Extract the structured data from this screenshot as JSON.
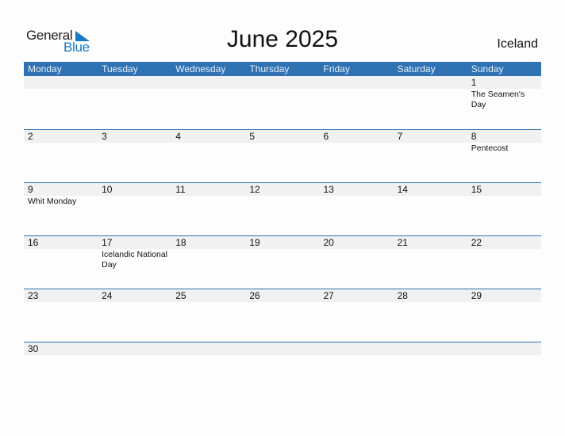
{
  "logo": {
    "line1": "General",
    "line2": "Blue"
  },
  "title": "June 2025",
  "country": "Iceland",
  "colors": {
    "accent": "#2e72b3",
    "strip": "#f1f1f1",
    "logo_blue": "#1a7bc4"
  },
  "weekdays": [
    "Monday",
    "Tuesday",
    "Wednesday",
    "Thursday",
    "Friday",
    "Saturday",
    "Sunday"
  ],
  "weeks": [
    {
      "days": [
        {
          "num": "",
          "event": ""
        },
        {
          "num": "",
          "event": ""
        },
        {
          "num": "",
          "event": ""
        },
        {
          "num": "",
          "event": ""
        },
        {
          "num": "",
          "event": ""
        },
        {
          "num": "",
          "event": ""
        },
        {
          "num": "1",
          "event": "The Seamen's Day"
        }
      ]
    },
    {
      "days": [
        {
          "num": "2",
          "event": ""
        },
        {
          "num": "3",
          "event": ""
        },
        {
          "num": "4",
          "event": ""
        },
        {
          "num": "5",
          "event": ""
        },
        {
          "num": "6",
          "event": ""
        },
        {
          "num": "7",
          "event": ""
        },
        {
          "num": "8",
          "event": "Pentecost"
        }
      ]
    },
    {
      "days": [
        {
          "num": "9",
          "event": "Whit Monday"
        },
        {
          "num": "10",
          "event": ""
        },
        {
          "num": "11",
          "event": ""
        },
        {
          "num": "12",
          "event": ""
        },
        {
          "num": "13",
          "event": ""
        },
        {
          "num": "14",
          "event": ""
        },
        {
          "num": "15",
          "event": ""
        }
      ]
    },
    {
      "days": [
        {
          "num": "16",
          "event": ""
        },
        {
          "num": "17",
          "event": "Icelandic National Day"
        },
        {
          "num": "18",
          "event": ""
        },
        {
          "num": "19",
          "event": ""
        },
        {
          "num": "20",
          "event": ""
        },
        {
          "num": "21",
          "event": ""
        },
        {
          "num": "22",
          "event": ""
        }
      ]
    },
    {
      "days": [
        {
          "num": "23",
          "event": ""
        },
        {
          "num": "24",
          "event": ""
        },
        {
          "num": "25",
          "event": ""
        },
        {
          "num": "26",
          "event": ""
        },
        {
          "num": "27",
          "event": ""
        },
        {
          "num": "28",
          "event": ""
        },
        {
          "num": "29",
          "event": ""
        }
      ]
    },
    {
      "days": [
        {
          "num": "30",
          "event": ""
        },
        {
          "num": "",
          "event": ""
        },
        {
          "num": "",
          "event": ""
        },
        {
          "num": "",
          "event": ""
        },
        {
          "num": "",
          "event": ""
        },
        {
          "num": "",
          "event": ""
        },
        {
          "num": "",
          "event": ""
        }
      ]
    }
  ]
}
